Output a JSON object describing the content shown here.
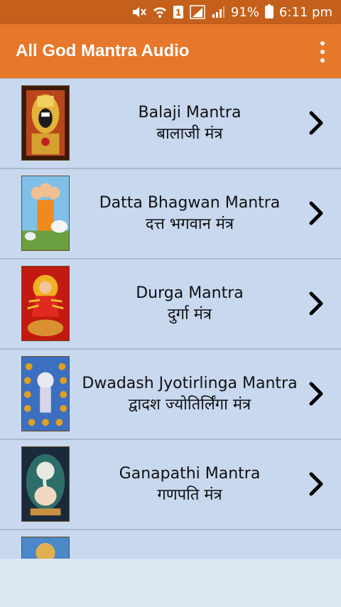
{
  "status_bar": {
    "battery_percent": "91%",
    "time": "6:11 pm",
    "icons": [
      "mute-icon",
      "wifi-icon",
      "sim-1-icon",
      "signal-icon",
      "signal-2-icon",
      "battery-charging-icon"
    ]
  },
  "app_bar": {
    "title": "All God Mantra Audio",
    "menu_icon": "more-vert-icon"
  },
  "colors": {
    "status_bar": "#c4601c",
    "app_bar": "#e7772a",
    "list_background": "#c8d8ef"
  },
  "mantras": [
    {
      "title": "Balaji Mantra",
      "subtitle": "बालाजी मंत्र",
      "image": "balaji-image"
    },
    {
      "title": "Datta Bhagwan Mantra",
      "subtitle": "दत्त भगवान मंत्र",
      "image": "datta-image"
    },
    {
      "title": "Durga Mantra",
      "subtitle": "दुर्गा मंत्र",
      "image": "durga-image"
    },
    {
      "title": "Dwadash Jyotirlinga Mantra",
      "subtitle": "द्वादश ज्योतिर्लिंगा मंत्र",
      "image": "jyotirlinga-image"
    },
    {
      "title": "Ganapathi Mantra",
      "subtitle": "गणपति मंत्र",
      "image": "ganapathi-image"
    }
  ]
}
